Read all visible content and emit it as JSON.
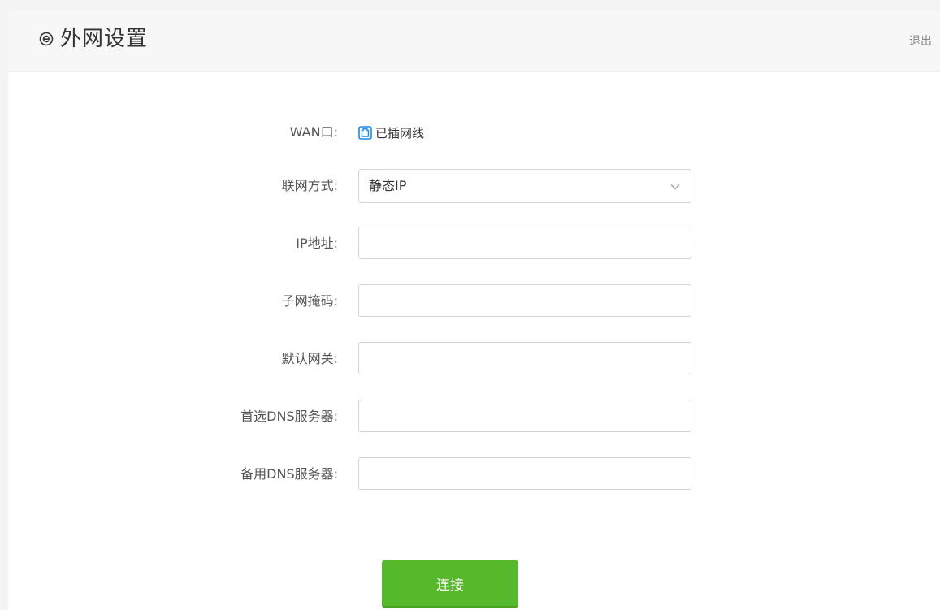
{
  "header": {
    "title": "外网设置",
    "logout_label": "退出"
  },
  "wan": {
    "label": "WAN口:",
    "status_text": "已插网线"
  },
  "connection_type": {
    "label": "联网方式:",
    "value": "静态IP"
  },
  "fields": {
    "ip": {
      "label": "IP地址:",
      "value": ""
    },
    "subnet": {
      "label": "子网掩码:",
      "value": ""
    },
    "gateway": {
      "label": "默认网关:",
      "value": ""
    },
    "primary_dns": {
      "label": "首选DNS服务器:",
      "value": ""
    },
    "secondary_dns": {
      "label": "备用DNS服务器:",
      "value": ""
    }
  },
  "actions": {
    "connect_label": "连接"
  },
  "colors": {
    "accent_green": "#56b92b",
    "port_icon_blue": "#1e88e5"
  },
  "icons": {
    "title": "settings-e-icon",
    "port": "ethernet-port-icon",
    "dropdown": "chevron-down-icon"
  }
}
